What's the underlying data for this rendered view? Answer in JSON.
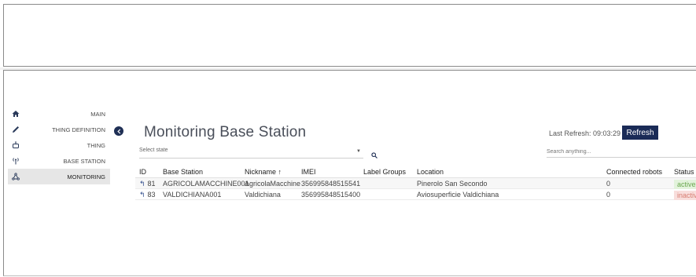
{
  "sidebar": {
    "items": [
      {
        "label": "MAIN",
        "icon": "home-icon",
        "active": false
      },
      {
        "label": "THING DEFINITION",
        "icon": "pencil-icon",
        "active": false
      },
      {
        "label": "THING",
        "icon": "robot-icon",
        "active": false
      },
      {
        "label": "BASE STATION",
        "icon": "antenna-icon",
        "active": false
      },
      {
        "label": "MONITORING",
        "icon": "network-icon",
        "active": true
      }
    ]
  },
  "header": {
    "title": "Monitoring Base Station",
    "last_refresh": "Last Refresh: 09:03:29",
    "refresh_label": "Refresh"
  },
  "filters": {
    "state_placeholder": "Select state",
    "search_placeholder": "Search anything..."
  },
  "table": {
    "columns": [
      "ID",
      "Base Station",
      "Nickname ↑",
      "IMEI",
      "Label Groups",
      "Location",
      "Connected robots",
      "Status"
    ],
    "rows": [
      {
        "id": "81",
        "base_station": "AGRICOLAMACCHINE001",
        "nickname": "AgricolaMacchine",
        "imei": "356995848515541",
        "label_groups": "",
        "location": "Pinerolo San Secondo",
        "connected_robots": "0",
        "status": "active"
      },
      {
        "id": "83",
        "base_station": "VALDICHIANA001",
        "nickname": "Valdichiana",
        "imei": "356995848515400",
        "label_groups": "",
        "location": "Aviosuperficie Valdichiana",
        "connected_robots": "0",
        "status": "inactive"
      }
    ]
  },
  "colors": {
    "accent": "#1a2b57",
    "active_bg": "#e3f3dc",
    "active_text": "#6aa84f",
    "inactive_bg": "#f8dedc",
    "inactive_text": "#d77d72"
  }
}
